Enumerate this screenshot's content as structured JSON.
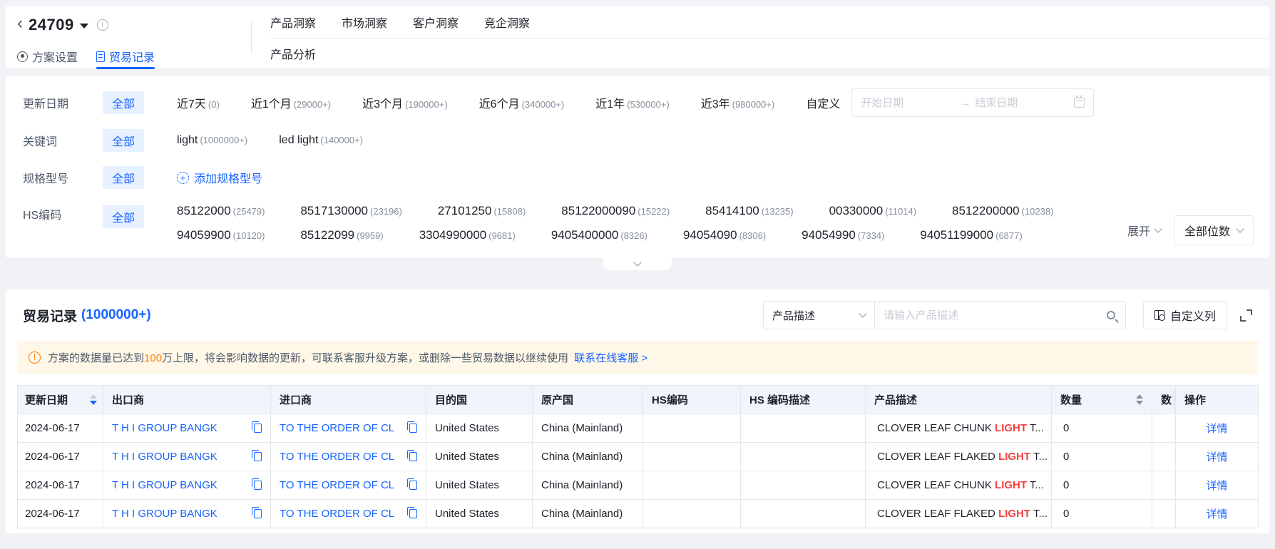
{
  "colors": {
    "primary": "#1664ff",
    "highlight_red": "#f53f3f",
    "warn_orange": "#ff7d00",
    "banner_bg": "#fff7e8",
    "chip_bg": "#e8f1ff"
  },
  "icons": {
    "back": "chevron-left",
    "plan_dropdown": "caret-down",
    "plan_info": "info-circle",
    "plan_settings": "gear-circle",
    "trade_records": "document",
    "add_spec": "plus-dashed-circle",
    "expand": "chevron-down",
    "digits": "chevron-down",
    "collapse_panel": "chevron-down",
    "search": "magnifier",
    "date_picker": "calendar",
    "customize_columns": "table-gear",
    "fullscreen": "expand-corners",
    "warning": "exclamation-circle",
    "copy": "copy-sheets",
    "sort": "caret-up-down"
  },
  "plan": {
    "id": "24709"
  },
  "nav": {
    "tabs": [
      "产品洞察",
      "市场洞察",
      "客户洞察",
      "竞企洞察"
    ],
    "sub_tab": "产品分析"
  },
  "left_tabs": {
    "settings": "方案设置",
    "trade_records": "贸易记录"
  },
  "filters": {
    "update_date": {
      "label": "更新日期",
      "all": "全部",
      "options": [
        {
          "label": "近7天",
          "count": "(0)"
        },
        {
          "label": "近1个月",
          "count": "(29000+)"
        },
        {
          "label": "近3个月",
          "count": "(190000+)"
        },
        {
          "label": "近6个月",
          "count": "(340000+)"
        },
        {
          "label": "近1年",
          "count": "(530000+)"
        },
        {
          "label": "近3年",
          "count": "(980000+)"
        }
      ],
      "custom_label": "自定义",
      "start_placeholder": "开始日期",
      "end_placeholder": "结束日期"
    },
    "keyword": {
      "label": "关键词",
      "all": "全部",
      "options": [
        {
          "label": "light",
          "count": "(1000000+)"
        },
        {
          "label": "led light",
          "count": "(140000+)"
        }
      ]
    },
    "spec": {
      "label": "规格型号",
      "all": "全部",
      "add_label": "添加规格型号"
    },
    "hs_code": {
      "label": "HS编码",
      "all": "全部",
      "options": [
        {
          "code": "85122000",
          "count": "(25479)"
        },
        {
          "code": "8517130000",
          "count": "(23196)"
        },
        {
          "code": "27101250",
          "count": "(15808)"
        },
        {
          "code": "85122000090",
          "count": "(15222)"
        },
        {
          "code": "85414100",
          "count": "(13235)"
        },
        {
          "code": "00330000",
          "count": "(11014)"
        },
        {
          "code": "8512200000",
          "count": "(10238)"
        },
        {
          "code": "94059900",
          "count": "(10120)"
        },
        {
          "code": "85122099",
          "count": "(9959)"
        },
        {
          "code": "3304990000",
          "count": "(9681)"
        },
        {
          "code": "9405400000",
          "count": "(8326)"
        },
        {
          "code": "94054090",
          "count": "(8306)"
        },
        {
          "code": "94054990",
          "count": "(7334)"
        },
        {
          "code": "94051199000",
          "count": "(6877)"
        }
      ],
      "expand_label": "展开",
      "digits_label": "全部位数"
    }
  },
  "trade": {
    "title": "贸易记录",
    "count": "(1000000+)",
    "search": {
      "field": "产品描述",
      "placeholder": "请输入产品描述"
    },
    "customize_label": "自定义列",
    "banner": {
      "prefix": "方案的数据量已达到",
      "highlight": "100",
      "suffix": "万上限，将会影响数据的更新，可联系客服升级方案，或删除一些贸易数据以继续使用",
      "link": "联系在线客服 >"
    },
    "table": {
      "columns": [
        "更新日期",
        "出口商",
        "进口商",
        "目的国",
        "原产国",
        "HS编码",
        "HS 编码描述",
        "产品描述",
        "数量",
        "数",
        "操作"
      ],
      "rows": [
        {
          "date": "2024-06-17",
          "exporter": "T H I GROUP BANGK",
          "importer": "TO THE ORDER OF CL",
          "destination": "United States",
          "origin": "China (Mainland)",
          "hs_code": "",
          "hs_description": "",
          "product": {
            "before": "CLOVER LEAF CHUNK ",
            "highlight": "LIGHT",
            "after": " T..."
          },
          "quantity": "0",
          "extra": "",
          "action": "详情"
        },
        {
          "date": "2024-06-17",
          "exporter": "T H I GROUP BANGK",
          "importer": "TO THE ORDER OF CL",
          "destination": "United States",
          "origin": "China (Mainland)",
          "hs_code": "",
          "hs_description": "",
          "product": {
            "before": "CLOVER LEAF FLAKED ",
            "highlight": "LIGHT",
            "after": " T..."
          },
          "quantity": "0",
          "extra": "",
          "action": "详情"
        },
        {
          "date": "2024-06-17",
          "exporter": "T H I GROUP BANGK",
          "importer": "TO THE ORDER OF CL",
          "destination": "United States",
          "origin": "China (Mainland)",
          "hs_code": "",
          "hs_description": "",
          "product": {
            "before": "CLOVER LEAF CHUNK ",
            "highlight": "LIGHT",
            "after": " T..."
          },
          "quantity": "0",
          "extra": "",
          "action": "详情"
        },
        {
          "date": "2024-06-17",
          "exporter": "T H I GROUP BANGK",
          "importer": "TO THE ORDER OF CL",
          "destination": "United States",
          "origin": "China (Mainland)",
          "hs_code": "",
          "hs_description": "",
          "product": {
            "before": "CLOVER LEAF FLAKED ",
            "highlight": "LIGHT",
            "after": " T..."
          },
          "quantity": "0",
          "extra": "",
          "action": "详情"
        }
      ]
    }
  }
}
